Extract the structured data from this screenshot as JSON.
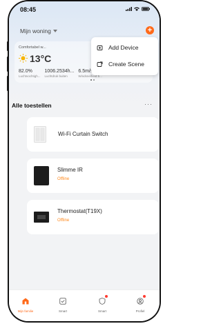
{
  "status": {
    "time": "08:45"
  },
  "header": {
    "home_label": "Mijn woning"
  },
  "weather": {
    "city": "Comfortabel w...",
    "temperature": "13°C",
    "stats": [
      {
        "value": "82.0%",
        "label": "Luchtvochtigh..."
      },
      {
        "value": "1006.2534h...",
        "label": "Luchtdruk buiten"
      },
      {
        "value": "6.5m/s",
        "label": "Windsnelheid b..."
      }
    ]
  },
  "menu": {
    "items": [
      {
        "label": "Add Device"
      },
      {
        "label": "Create Scene"
      }
    ]
  },
  "devices_section": {
    "title": "Alle toestellen"
  },
  "devices": [
    {
      "name": "Wi-Fi Curtain Switch"
    },
    {
      "name": "Slimme IR",
      "status": "Offline"
    },
    {
      "name": "Thermostat(T19X)",
      "status": "Offline"
    }
  ],
  "tabbar": {
    "tabs": [
      {
        "label": "Mijn familie"
      },
      {
        "label": "Smart"
      },
      {
        "label": "Smart"
      },
      {
        "label": "Profiel"
      }
    ]
  },
  "colors": {
    "accent": "#ff6a1a",
    "offline": "#ff8a1f"
  }
}
